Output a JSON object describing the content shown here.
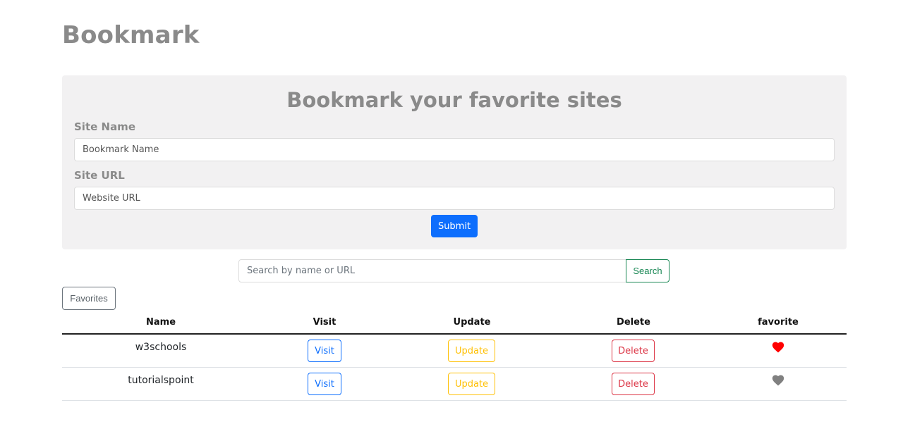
{
  "page": {
    "title": "Bookmark"
  },
  "form": {
    "heading": "Bookmark your favorite sites",
    "site_name_label": "Site Name",
    "site_name_placeholder": "Bookmark Name",
    "site_url_label": "Site URL",
    "site_url_placeholder": "Website URL",
    "submit_label": "Submit"
  },
  "search": {
    "placeholder": "Search by name or URL",
    "button_label": "Search"
  },
  "favorites_button": "Favorites",
  "table": {
    "headers": [
      "Name",
      "Visit",
      "Update",
      "Delete",
      "favorite"
    ],
    "rows": [
      {
        "name": "w3schools",
        "visit": "Visit",
        "update": "Update",
        "delete": "Delete",
        "favorite": true
      },
      {
        "name": "tutorialspoint",
        "visit": "Visit",
        "update": "Update",
        "delete": "Delete",
        "favorite": false
      }
    ]
  },
  "colors": {
    "favorite_active": "#ff0000",
    "favorite_inactive": "#808080",
    "primary": "#0d6efd",
    "success": "#198754",
    "warning": "#ffc107",
    "danger": "#dc3545"
  },
  "icons": {
    "favorite": "heart-icon"
  }
}
